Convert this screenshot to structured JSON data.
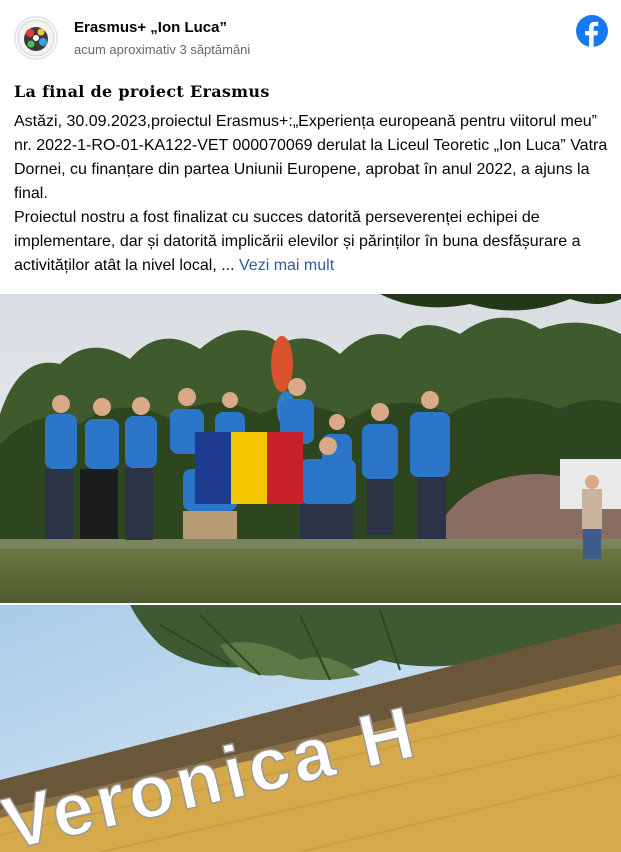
{
  "post": {
    "page_name": "Erasmus+ „Ion Luca”",
    "time": "acum aproximativ 3 săptămâni",
    "title": "La final de proiect Erasmus",
    "paragraph1": "Astăzi, 30.09.2023,proiectul Erasmus+:„Experiența europeană pentru viitorul meu” nr. 2022-1-RO-01-KA122-VET 000070069 derulat la Liceul Teoretic „Ion Luca” Vatra Dornei, cu finanțare din partea Uniunii Europene, aprobat în anul 2022, a ajuns la final.",
    "paragraph2": "Proiectul nostru a fost finalizat cu succes datorită perseverenței echipei de implementare, dar și datorită implicării elevilor și părinților în buna desfășurare a activităților atât la nivel local, ...",
    "see_more": "Vezi mai mult"
  },
  "photo2": {
    "sign_text": "Veronica H"
  },
  "icons": {
    "facebook": "facebook-logo-icon",
    "avatar": "school-logo"
  },
  "colors": {
    "facebook_blue": "#1877f2",
    "link": "#385898",
    "secondary_text": "#65676b"
  }
}
